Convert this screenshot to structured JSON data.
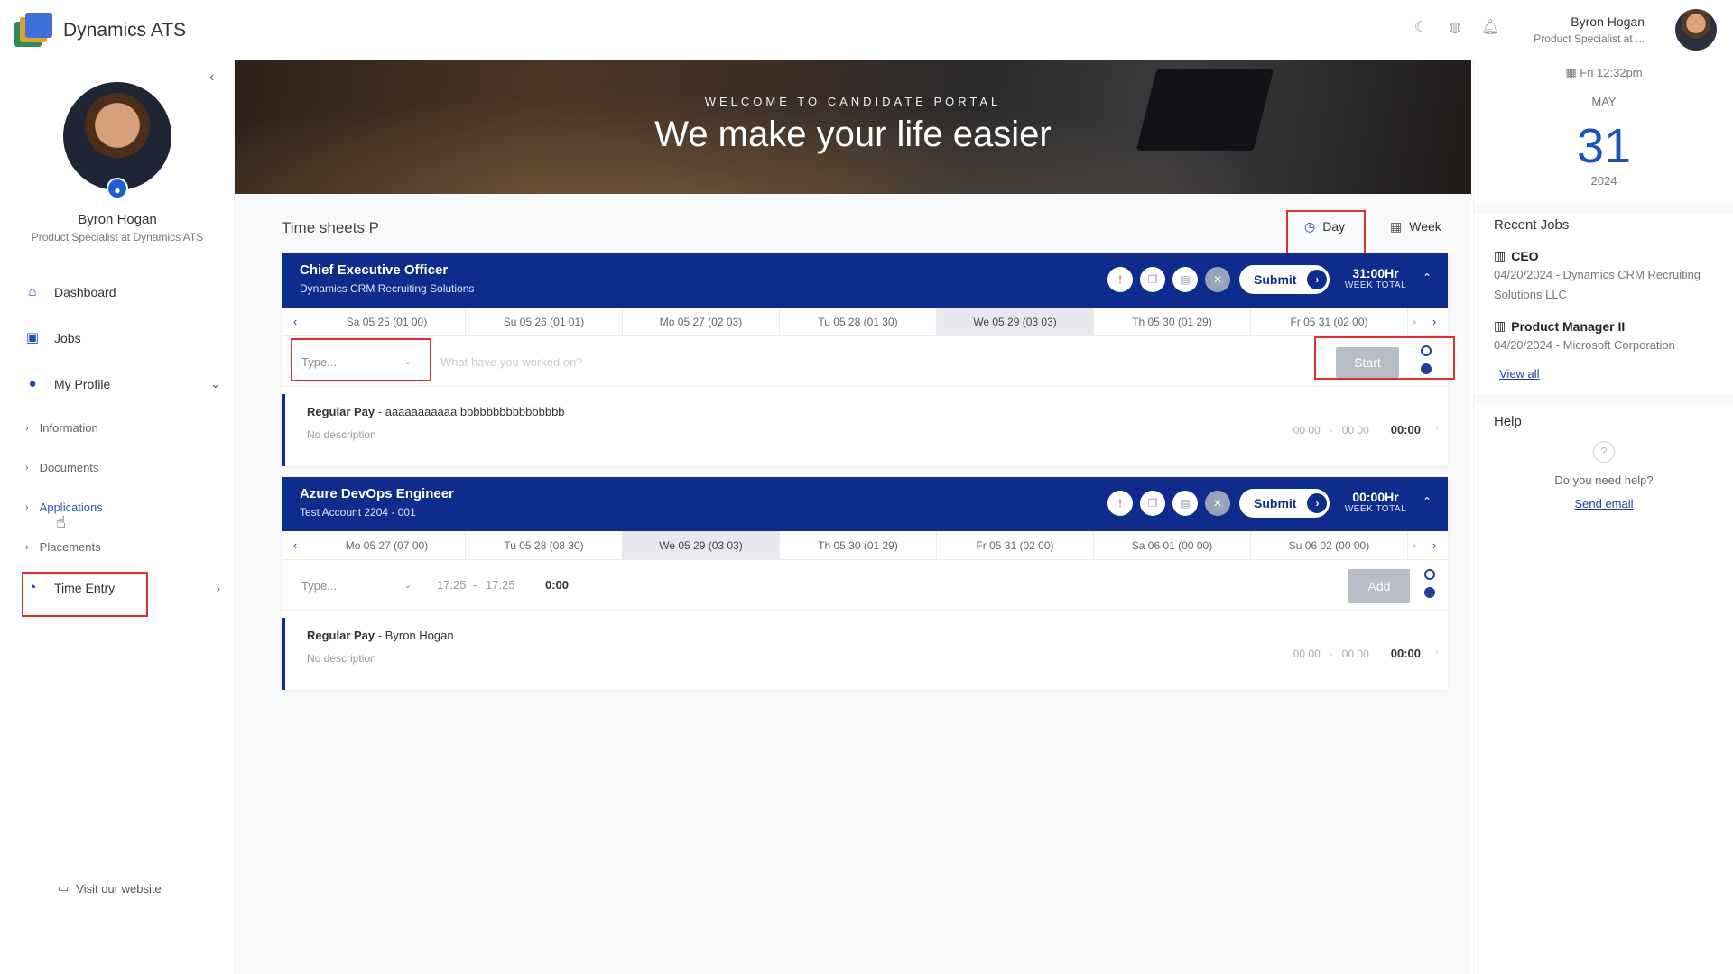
{
  "brand": {
    "name": "Dynamics ATS"
  },
  "header": {
    "user_name": "Byron Hogan",
    "user_role": "Product Specialist at ..."
  },
  "sidebar": {
    "profile_name": "Byron Hogan",
    "profile_title": "Product Specialist at Dynamics ATS",
    "items": [
      {
        "label": "Dashboard",
        "icon": "home-icon"
      },
      {
        "label": "Jobs",
        "icon": "briefcase-icon"
      },
      {
        "label": "My Profile",
        "icon": "user-icon"
      }
    ],
    "sub_items": [
      "Information",
      "Documents",
      "Applications",
      "Placements"
    ],
    "time_entry_label": "Time Entry",
    "visit_label": "Visit our website"
  },
  "banner": {
    "kicker": "WELCOME TO CANDIDATE PORTAL",
    "title": "We make your life easier"
  },
  "main": {
    "title": "Time sheets P",
    "view_day": "Day",
    "view_week": "Week",
    "cards": [
      {
        "title": "Chief Executive Officer",
        "subtitle": "Dynamics CRM Recruiting Solutions",
        "submit_label": "Submit",
        "week_total_value": "31:00Hr",
        "week_total_label": "WEEK TOTAL",
        "days": [
          "Sa 05 25 (01 00)",
          "Su 05 26 (01 01)",
          "Mo 05 27 (02 03)",
          "Tu 05 28 (01 30)",
          "We 05 29 (03 03)",
          "Th 05 30 (01 29)",
          "Fr 05 31 (02 00)"
        ],
        "type_placeholder": "Type...",
        "what_placeholder": "What have you worked on?",
        "action_label": "Start",
        "entry": {
          "pay_type": "Regular Pay",
          "detail": " - aaaaaaaaaaa bbbbbbbbbbbbbbbb",
          "description": "No description",
          "start": "00 00",
          "end": "00 00",
          "total": "00:00"
        }
      },
      {
        "title": "Azure DevOps Engineer",
        "subtitle": "Test Account 2204 - 001",
        "submit_label": "Submit",
        "week_total_value": "00:00Hr",
        "week_total_label": "WEEK TOTAL",
        "days": [
          "Mo 05 27 (07 00)",
          "Tu 05 28 (08 30)",
          "We 05 29 (03 03)",
          "Th 05 30 (01 29)",
          "Fr 05 31 (02 00)",
          "Sa 06 01 (00 00)",
          "Su 06 02 (00 00)"
        ],
        "type_placeholder": "Type...",
        "time_from": "17:25",
        "time_to": "17:25",
        "duration": "0:00",
        "action_label": "Add",
        "entry": {
          "pay_type": "Regular Pay",
          "detail": " - Byron Hogan",
          "description": "No description",
          "start": "00 00",
          "end": "00 00",
          "total": "00:00"
        }
      }
    ]
  },
  "right": {
    "date_line": "Fri 12:32pm",
    "month": "MAY",
    "day": "31",
    "year": "2024",
    "recent_heading": "Recent Jobs",
    "jobs": [
      {
        "title": "CEO",
        "meta": "04/20/2024 - Dynamics CRM Recruiting Solutions LLC"
      },
      {
        "title": "Product Manager II",
        "meta": "04/20/2024 - Microsoft Corporation"
      }
    ],
    "view_all": "View all",
    "help_heading": "Help",
    "help_text": "Do you need help?",
    "send_email": "Send email"
  },
  "colors": {
    "primary": "#0d2c8c",
    "accent_red": "#e03030",
    "link": "#1f3f9a"
  }
}
